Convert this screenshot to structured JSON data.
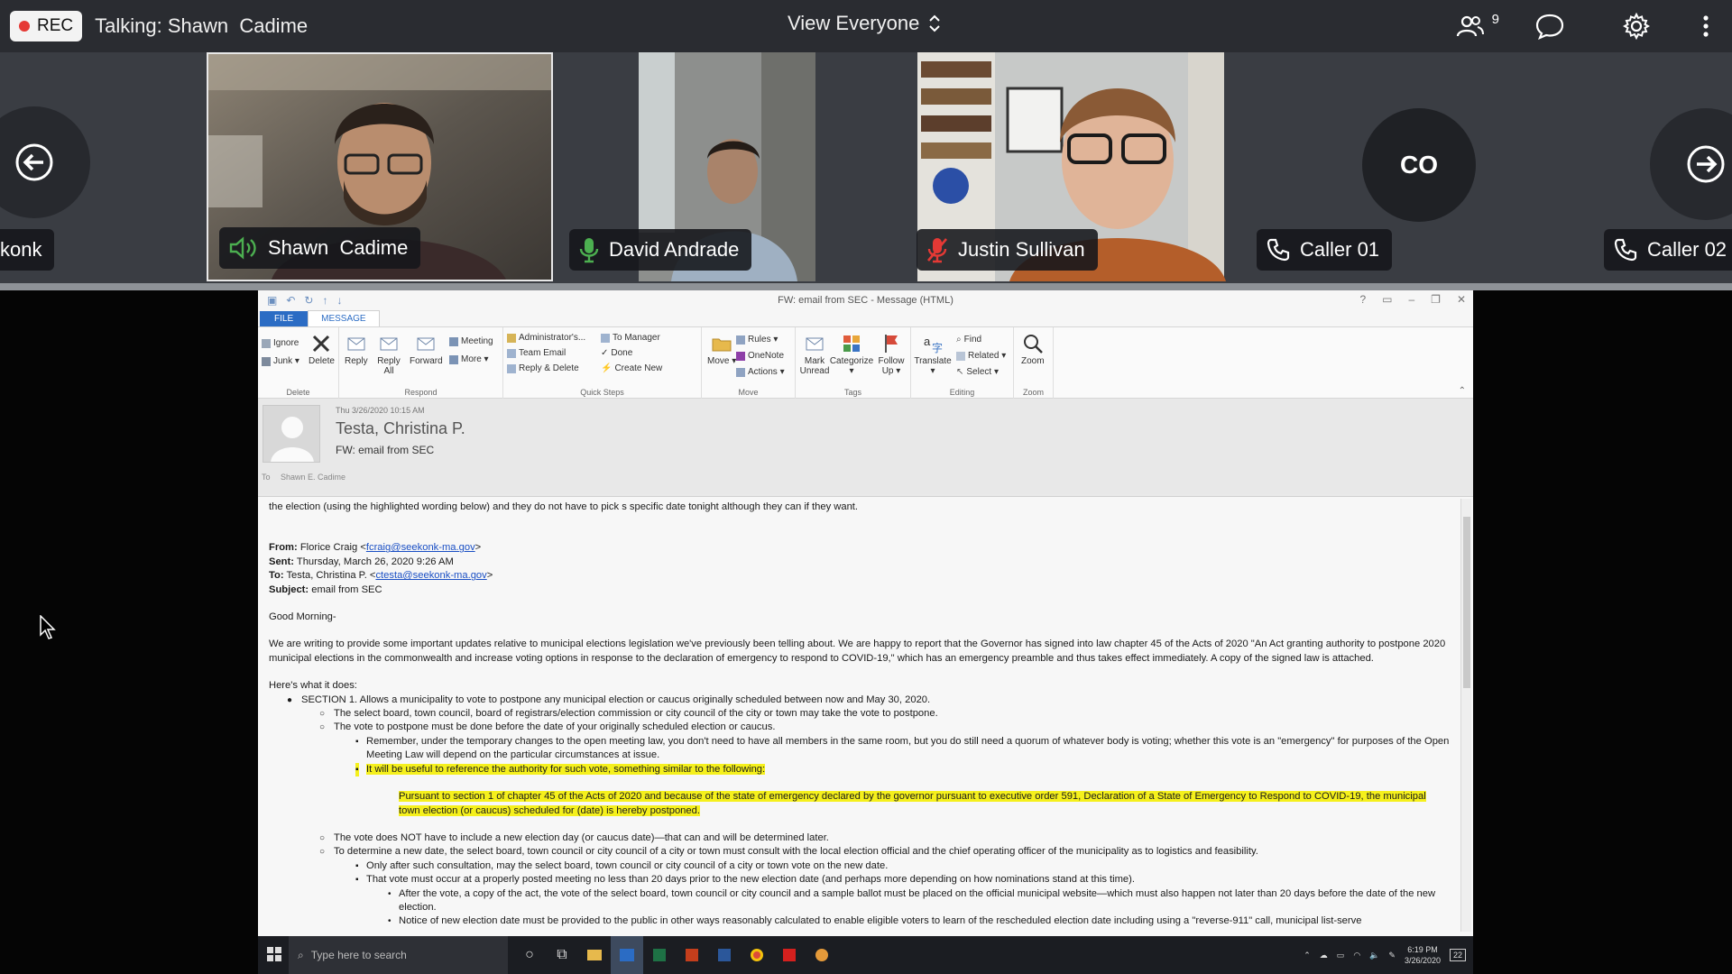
{
  "topbar": {
    "rec_label": "REC",
    "talking": "Talking: Shawn  Cadime",
    "view_label": "View Everyone",
    "participant_count": "9"
  },
  "participants": [
    {
      "name": "konk",
      "status": "partial"
    },
    {
      "name": "Shawn  Cadime",
      "status": "speaking"
    },
    {
      "name": "David Andrade",
      "status": "mic-on"
    },
    {
      "name": "Justin Sullivan",
      "status": "muted"
    },
    {
      "name": "Caller 01",
      "status": "phone",
      "initials": "CO"
    },
    {
      "name": "Caller 02",
      "status": "phone"
    }
  ],
  "outlook": {
    "window_title": "FW: email from SEC - Message (HTML)",
    "tabs": [
      "FILE",
      "MESSAGE"
    ],
    "ribbon": {
      "delete_group": {
        "name": "Delete",
        "ignore": "Ignore",
        "junk": "Junk ▾",
        "delete": "Delete"
      },
      "respond_group": {
        "name": "Respond",
        "reply": "Reply",
        "reply_all": "Reply All",
        "forward": "Forward",
        "meeting": "Meeting",
        "more": "More ▾"
      },
      "quicksteps_group": {
        "name": "Quick Steps",
        "items": [
          "Administrator's...",
          "Team Email",
          "Reply & Delete",
          "To Manager",
          "Done",
          "Create New"
        ]
      },
      "move_group": {
        "name": "Move",
        "move": "Move ▾",
        "rules": "Rules ▾",
        "onenote": "OneNote",
        "actions": "Actions ▾"
      },
      "tags_group": {
        "name": "Tags",
        "mark_unread": "Mark Unread",
        "categorize": "Categorize ▾",
        "follow_up": "Follow Up ▾"
      },
      "editing_group": {
        "name": "Editing",
        "translate": "Translate ▾",
        "find": "Find",
        "related": "Related ▾",
        "select": "Select ▾"
      },
      "zoom_group": {
        "name": "Zoom",
        "zoom": "Zoom"
      }
    },
    "header": {
      "date": "Thu 3/26/2020 10:15 AM",
      "from": "Testa, Christina P.",
      "subject": "FW: email from SEC",
      "to_label": "To",
      "to_name": "Shawn E. Cadime"
    },
    "body": {
      "line0": "the election (using the highlighted wording below) and they do not have to pick s specific date tonight although they can if they want.",
      "from_label": "From:",
      "from_name": "Florice Craig <",
      "from_email": "fcraig@seekonk-ma.gov",
      "from_end": ">",
      "sent_label": "Sent:",
      "sent_value": "Thursday, March 26, 2020 9:26 AM",
      "to_label": "To:",
      "to_name": "Testa, Christina P. <",
      "to_email": "ctesta@seekonk-ma.gov",
      "to_end": ">",
      "subject_label": "Subject:",
      "subject_value": "email from SEC",
      "greeting": "Good Morning-",
      "para1": "We are writing to provide some important updates relative to municipal elections legislation we've previously been telling about. We are happy to report that the Governor has signed into law chapter 45 of the Acts of 2020 \"An Act granting authority to postpone 2020 municipal elections in the commonwealth and increase voting options in response to the declaration of emergency to respond to COVID-19,\" which has an emergency preamble and thus takes effect immediately.  A copy of the signed law is attached.",
      "heres": "Here's what it does:",
      "section1": "SECTION 1. Allows a municipality to vote to postpone any municipal election or caucus originally scheduled between now and May 30, 2020.",
      "s1a": "The select board, town council, board of registrars/election commission or city council of the city or town may take the vote to postpone.",
      "s1b": "The vote to postpone must be done before the date of your originally scheduled election or caucus.",
      "s1b1": "Remember, under the temporary changes to the open meeting law, you don't need to have all members in the same room, but you do still need a quorum of whatever body is voting; whether this vote is an \"emergency\" for purposes of the Open Meeting Law will depend on the particular circumstances at issue.",
      "s1b2": "It will be useful to reference the authority for such vote, something similar to the following:",
      "quote": "Pursuant to section 1 of chapter 45 of the Acts of 2020 and because of the state of emergency declared by the governor pursuant to executive order 591, Declaration of a State of Emergency to Respond to COVID-19, the municipal town election (or caucus) scheduled for (date) is hereby postponed.",
      "s1c": "The vote does NOT have to include a new election day (or caucus date)—that can and will be determined later.",
      "s1d": "To determine a new date, the select board, town council or city council of a city or town must consult with the local election official and the chief operating officer of the municipality as to logistics and feasibility.",
      "s1d1": "Only after such consultation, may the select board, town council or city council of a city or town vote on the new date.",
      "s1d2": "That vote must occur at a properly posted meeting no less than 20 days prior to the new election date (and perhaps more depending on how nominations stand at this time).",
      "s1d2a": "After the vote, a copy of the act, the vote of the select board, town council or city council and a sample ballot must be placed on the official municipal website—which must also happen not later than 20 days before the date of the new election.",
      "s1d2b": "Notice of new election date must be provided to the public in other ways reasonably calculated to enable eligible voters to learn of the rescheduled election date including using a \"reverse-911\" call, municipal list-serve"
    },
    "taskbar": {
      "search_placeholder": "Type here to search",
      "time": "6:19 PM",
      "date": "3/26/2020",
      "notif": "22"
    }
  },
  "colors": {
    "topbar": "#2a2c31",
    "strip": "#3a3d43",
    "rec_dot": "#e53935",
    "speaking_green": "#4caf50",
    "muted_red": "#e53935",
    "outlook_blue": "#2b6cc4",
    "highlight": "#f5f01c"
  }
}
